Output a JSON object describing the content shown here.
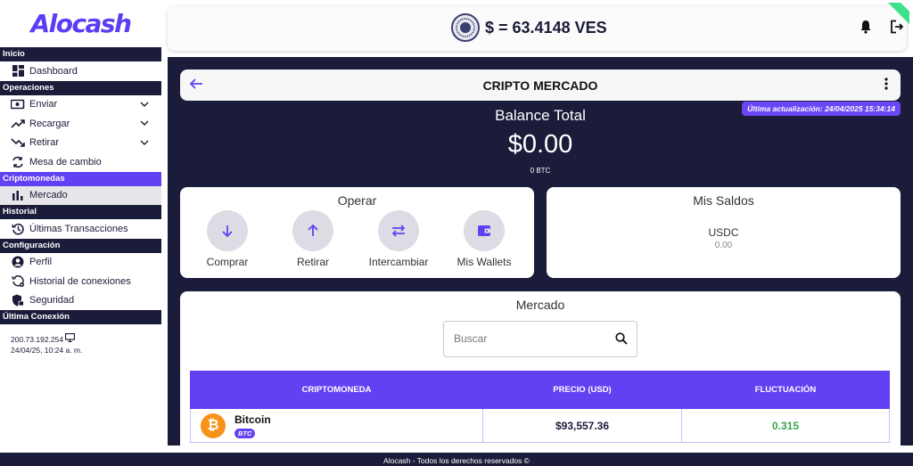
{
  "app": {
    "logo": "Alocash"
  },
  "sidebar": {
    "sections": [
      {
        "title": "Inicio",
        "items": [
          {
            "label": "Dashboard",
            "icon": "dashboard-icon"
          }
        ]
      },
      {
        "title": "Operaciones",
        "items": [
          {
            "label": "Enviar",
            "icon": "send-money-icon"
          },
          {
            "label": "Recargar",
            "icon": "trending-up-icon"
          },
          {
            "label": "Retirar",
            "icon": "trending-down-icon"
          },
          {
            "label": "Mesa de cambio",
            "icon": "exchange-icon"
          }
        ]
      },
      {
        "title": "Criptomonedas",
        "items": [
          {
            "label": "Mercado",
            "icon": "bar-chart-icon"
          }
        ]
      },
      {
        "title": "Historial",
        "items": [
          {
            "label": "Últimas Transacciones",
            "icon": "history-icon"
          }
        ]
      },
      {
        "title": "Configuración",
        "items": [
          {
            "label": "Perfil",
            "icon": "user-icon"
          },
          {
            "label": "Historial de conexiones",
            "icon": "connection-history-icon"
          },
          {
            "label": "Seguridad",
            "icon": "security-icon"
          }
        ]
      },
      {
        "title": "Última Conexión"
      }
    ],
    "last_connection": {
      "ip": "200.73.192.254",
      "datetime": "24/04/25, 10:24 a. m."
    }
  },
  "topbar": {
    "rate": "$ = 63.4148 VES"
  },
  "page": {
    "title": "CRIPTO MERCADO",
    "last_update": "Última actualización: 24/04/2025 15:34:14",
    "balance": {
      "title": "Balance Total",
      "amount": "$0.00",
      "btc": "0 BTC"
    },
    "operar": {
      "title": "Operar",
      "actions": [
        {
          "label": "Comprar",
          "icon": "arrow-down-icon"
        },
        {
          "label": "Retirar",
          "icon": "arrow-up-icon"
        },
        {
          "label": "Intercambiar",
          "icon": "swap-icon"
        },
        {
          "label": "Mis Wallets",
          "icon": "wallet-icon"
        }
      ]
    },
    "saldos": {
      "title": "Mis Saldos",
      "currency": "USDC",
      "amount": "0.00"
    },
    "mercado": {
      "title": "Mercado",
      "search_placeholder": "Buscar",
      "columns": [
        "CRIPTOMONEDA",
        "PRECIO (USD)",
        "FLUCTUACIÓN"
      ],
      "rows": [
        {
          "name": "Bitcoin",
          "symbol": "BTC",
          "price": "$93,557.36",
          "fluctuation": "0.315"
        }
      ]
    }
  },
  "footer": {
    "text": "Alocash - Todos los derechos reservados ©"
  },
  "colors": {
    "accent": "#6241f3",
    "navy": "#1b1b3a",
    "positive": "#3aa34b",
    "bitcoin": "#f7931a"
  }
}
